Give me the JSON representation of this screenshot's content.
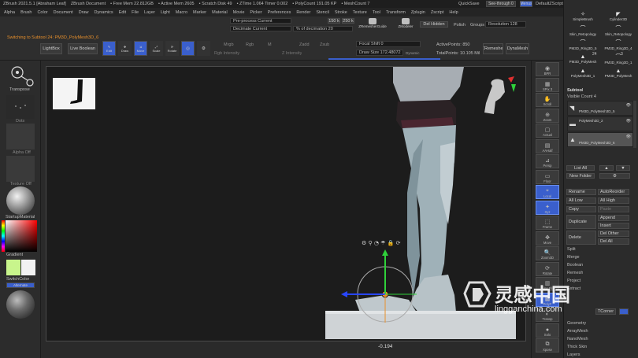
{
  "title_bar": {
    "items": [
      "ZBrush 2021.5.1 [Abraham Leaf]",
      "ZBrush Document",
      "• Free Mem 22.812GB",
      "• Active Mem 2605",
      "• Scratch Disk 49",
      "• ZTime 1.064 Timer 0.002",
      "• PolyCount 191.05 KP",
      "• MeshCount 7"
    ],
    "quicksave": "QuickSave",
    "seethrough": "See-through  0",
    "menus_label": "Menus",
    "defaultzscript": "DefaultZScript"
  },
  "menubar": [
    "Alpha",
    "Brush",
    "Color",
    "Document",
    "Draw",
    "Dynamics",
    "Edit",
    "File",
    "Layer",
    "Light",
    "Macro",
    "Marker",
    "Material",
    "Movie",
    "Picker",
    "Preferences",
    "Render",
    "Stencil",
    "Stroke",
    "Texture",
    "Tool",
    "Transform",
    "Zplugin",
    "Zscript",
    "Help"
  ],
  "toolbar": {
    "status": "Switching to Subtool 24:  PM3D_PolyMesh3D_6",
    "preprocess": "Pre-process Current",
    "decimate": "Decimate Current",
    "pct_label": "% of decimation",
    "pct_value": "20",
    "k1": "150 k",
    "k2": "250 k",
    "zremesher": "ZRemesherGuide",
    "zmodeler": "ZModeler",
    "del_hidden": "Del Hidden",
    "polish": "Polish",
    "groups": "Groups",
    "resolution": "Resolution",
    "resolution_value": "128",
    "lightbox": "LightBox",
    "live_boolean": "Live Boolean",
    "edit": "Edit",
    "draw": "Draw",
    "move": "Move",
    "scale": "Scale",
    "rotate": "Rotate",
    "mrgb": "Mrgb",
    "rgb": "Rgb",
    "m": "M",
    "zadd": "Zadd",
    "zsub": "Zsub",
    "rgb_intensity": "Rgb Intensity",
    "z_intensity": "Z Intensity",
    "focal_shift_label": "Focal Shift",
    "focal_shift_value": "0",
    "draw_size_label": "Draw Size",
    "draw_size_value": "172.48072",
    "dynamic": "Dynamic",
    "active_points": "ActivePoints: 850",
    "total_points": "TotalPoints: 10.105 Mil",
    "zremesher2": "ZRemesher",
    "dynamesh": "DynaMesh"
  },
  "left_panel": {
    "transpose": "Transpose",
    "dots": "Dots",
    "alpha_off": "Alpha Off",
    "texture_off": "Texture Off",
    "material": "StartupMaterial",
    "gradient": "Gradient",
    "switchcolor": "SwitchColor",
    "alternate": "Alternate"
  },
  "viewport": {
    "readout": "-0.194"
  },
  "right_strip": [
    {
      "name": "bpr",
      "label": "BPR"
    },
    {
      "name": "spix",
      "label": "SPix 3"
    },
    {
      "name": "scroll",
      "label": "Scroll"
    },
    {
      "name": "zoom",
      "label": "Zoom"
    },
    {
      "name": "actual",
      "label": "Actual"
    },
    {
      "name": "aahalf",
      "label": "AAHalf"
    },
    {
      "name": "persp",
      "label": "Persp"
    },
    {
      "name": "floor",
      "label": "Floor"
    },
    {
      "name": "local",
      "label": "Local"
    },
    {
      "name": "xyz",
      "label": "Xyz"
    },
    {
      "name": "frame",
      "label": "Frame"
    },
    {
      "name": "move",
      "label": "Move"
    },
    {
      "name": "zoom3d",
      "label": "Zoom3D"
    },
    {
      "name": "rotate",
      "label": "Rotate"
    },
    {
      "name": "linefill",
      "label": "Line Fill"
    },
    {
      "name": "polyf",
      "label": "PolyF"
    },
    {
      "name": "transp",
      "label": "Transp"
    },
    {
      "name": "solo",
      "label": "Solo"
    },
    {
      "name": "xpose",
      "label": "Xpose"
    }
  ],
  "right_panel": {
    "brushes": [
      "SimpleBrush",
      "Cylinder3D",
      "Skin_Retopology",
      "Skin_Retopology",
      "PM3D_Ring3D_5",
      "PM3D_Ring3D_4",
      "PM3D_PolyMesh",
      "PM3D_Ring3D_1",
      "PolyMesh3D_1",
      "PM3D_PolyMesh"
    ],
    "counts": [
      "24",
      "3"
    ],
    "subtool_title": "Subtool",
    "visible_count": "Visible Count  4",
    "subtools": [
      "PM3D_PolyMesh3D_5",
      "PolyMesh3D_2",
      "PM3D_PolyMesh3D_6"
    ],
    "list_all": "List All",
    "new_folder": "New Folder",
    "rename": "Rename",
    "autoreorder": "AutoReorder",
    "all_low": "All Low",
    "all_high": "All High",
    "copy": "Copy",
    "paste": "Paste",
    "append": "Append",
    "duplicate": "Duplicate",
    "insert": "Insert",
    "delete": "Delete",
    "del_other": "Del Other",
    "del_all": "Del All",
    "split": "Split",
    "merge": "Merge",
    "boolean": "Boolean",
    "remesh": "Remesh",
    "project": "Project",
    "extract": "Extract",
    "tcorner": "TCorner",
    "geometry": "Geometry",
    "arraymesh": "ArrayMesh",
    "nanomesh": "NanoMesh",
    "thick_skin": "Thick Skin",
    "layers": "Layers"
  },
  "watermark": {
    "cn": "灵感中国",
    "url": "lingganchina.com"
  },
  "colors": {
    "accent_blue": "#3a5fcc",
    "orange": "#e8902c",
    "green_axis": "#2fd13a",
    "red_axis": "#e03030"
  }
}
